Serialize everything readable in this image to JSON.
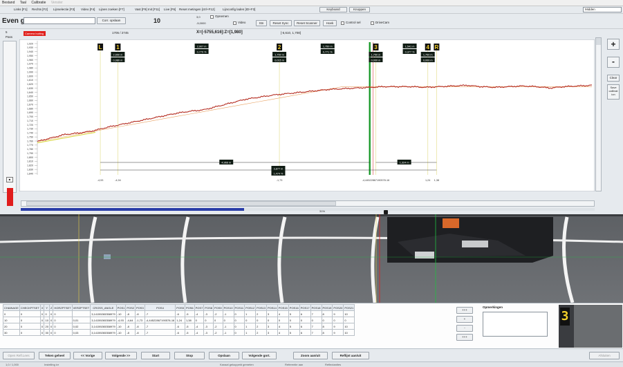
{
  "menu": [
    "Bestand",
    "Taal",
    "Calibratie",
    "Venster"
  ],
  "toolbar1": {
    "items": [
      "Links [F1]",
      "Rechts [F2]",
      "Lijnselectie [F3]",
      "Video [F4]",
      "Lijnen zoeken [F7]",
      "Vast [F9]",
      "Init [F11]",
      "Live [F6]",
      "Reset metingen [ctrl+F12]",
      "Lijnconfig laden [ID+F3]"
    ],
    "keyboard": "Keyboard",
    "knoppen": "Knoppen",
    "right_field": "Midden"
  },
  "toolbar2": {
    "title": "Even gi",
    "corr_button": "Corr. opslaan",
    "number": "10",
    "val1": "3,0",
    "val2": "-5,0000",
    "opnemen": "Opnemen",
    "video": "Video",
    "stn": "Stn",
    "reset_sync": "Reset Sync",
    "reset_scanner": "Reset Scanner",
    "hoek": "Hoek",
    "control_cb": "Control sel",
    "drivecam_cb": "DriveCam"
  },
  "chart_header": {
    "red_badge": "Camera buiting",
    "range": "1705 / 2745",
    "coords": "X=[-5755,616]:Z=[1,980]",
    "coords2": "[-5,610, 1,708]",
    "left_label": "5",
    "left_sub": "Pass"
  },
  "chart_data": {
    "type": "line",
    "yticks": [
      "1,920",
      "1,930",
      "1,940",
      "1,950",
      "1,960",
      "1,970",
      "1,980",
      "1,990",
      "1,600",
      "1,610",
      "1,620",
      "1,630",
      "1,640",
      "1,650",
      "1,660",
      "1,670",
      "1,680",
      "1,690",
      "1,700",
      "1,710",
      "1,720",
      "1,730",
      "1,740",
      "1,750",
      "1,760",
      "1,770",
      "1,780",
      "1,790",
      "1,800",
      "1,810",
      "1,820",
      "1,830",
      "1,840"
    ],
    "xticks": [
      "-4,93",
      "-4,94",
      "-1,73",
      "-4,44522867190578-16",
      "1,24",
      "1,38"
    ],
    "markers": [
      "L",
      "1",
      "2",
      "3",
      "4",
      "R"
    ],
    "marker_values": [
      [
        "2,650 m",
        "0,080 m"
      ],
      [
        "1,750 m",
        "0,015 m"
      ],
      [
        "1,750 m",
        "0,000 m"
      ],
      [
        "1,750 m",
        "0,000 m"
      ]
    ],
    "top_labels": [
      "2,907 m",
      "0,779 %",
      "1,750 m",
      "0,771 %",
      "1,541 m",
      "0,377 %"
    ],
    "bottom_labels": [
      "4,966 m",
      "3,877 m",
      "1,474 %",
      "1,324 m"
    ],
    "series": [
      {
        "values": [
          1.82,
          1.815,
          1.81,
          1.808,
          1.805,
          1.8,
          1.796,
          1.792,
          1.788,
          1.784,
          1.78,
          1.777,
          1.775,
          1.77,
          1.765,
          1.76,
          1.757,
          1.754,
          1.752,
          1.75,
          1.748,
          1.746,
          1.745,
          1.744,
          1.743,
          1.742,
          1.742,
          1.742,
          1.743,
          1.742,
          1.741,
          1.74,
          1.742,
          1.743,
          1.742,
          1.741,
          1.742,
          1.744,
          1.742,
          1.741,
          1.74
        ]
      }
    ]
  },
  "scroll": {
    "percent": "31%"
  },
  "table": {
    "headers": [
      "CHAINAGE",
      "CHECKPTSET",
      "X",
      "Y",
      "Z",
      "HORZPTSET",
      "VERZPTSET",
      "CROSS_ANGLE",
      "POS1",
      "POS2",
      "POS3",
      "POS4",
      "POS5",
      "POS6",
      "POS7",
      "POS8",
      "POS9",
      "POS10",
      "POS11",
      "POS12",
      "POS13",
      "POS14",
      "POS15",
      "POS16",
      "POS17",
      "POS18",
      "POS19",
      "POS20",
      "POS21"
    ],
    "rows": [
      [
        "0",
        "0",
        "0",
        "0",
        "0",
        "0",
        "",
        "3,14159265358979",
        "-10",
        "-8",
        "-8",
        "-7",
        "-6",
        "-5",
        "-4",
        "-3",
        "-2",
        "-1",
        "0",
        "1",
        "2",
        "3",
        "4",
        "5",
        "6",
        "7",
        "8",
        "9",
        "10"
      ],
      [
        "10",
        "0",
        "0",
        "10",
        "0",
        "0",
        "0,01",
        "3,14159265358979",
        "-4,93",
        "-4,64",
        "-1,73",
        "-4,44522867190578-16",
        "1,24",
        "1,38",
        "0",
        "0",
        "0",
        "0",
        "0",
        "0",
        "0",
        "0",
        "0",
        "0",
        "0",
        "0",
        "0",
        "0",
        "0"
      ],
      [
        "20",
        "0",
        "0",
        "20",
        "0",
        "0",
        "0,02",
        "3,14159265358979",
        "-10",
        "-8",
        "-8",
        "-7",
        "-6",
        "-5",
        "-4",
        "-3",
        "-2",
        "-1",
        "0",
        "1",
        "2",
        "3",
        "4",
        "5",
        "6",
        "7",
        "8",
        "9",
        "10"
      ],
      [
        "30",
        "0",
        "0",
        "30",
        "0",
        "0",
        "0,03",
        "3,14159265358979",
        "-10",
        "-8",
        "-8",
        "-7",
        "-6",
        "-5",
        "-4",
        "-3",
        "-2",
        "-1",
        "0",
        "1",
        "2",
        "3",
        "4",
        "5",
        "6",
        "7",
        "8",
        "9",
        "10"
      ]
    ],
    "nav_buttons": [
      "+++",
      "+",
      "-",
      "+++"
    ],
    "opmerkingen": "Opmerkingen",
    "preview_digit": "3"
  },
  "bottom_buttons": [
    "Open Refl.Lees",
    "Teken geheel",
    "<< Vorige",
    "Volgende >>",
    "Start",
    "Stop",
    "Opslaan",
    "Volgende gort.",
    "Zoom aan/uit",
    "Reflijst aan/uit",
    "Afsluiten"
  ],
  "side_buttons": {
    "plus": "+",
    "minus": "-",
    "clear": "Clear",
    "save": "Save calibrat ion"
  },
  "status": [
    "1,0 / 1,000",
    "Instelling ivr",
    "Kanaal gekoppeld gemeten",
    "Referentie aan",
    "Reflectanties"
  ],
  "colors": {
    "measured": "#b42a1e",
    "fit": "#e8a060",
    "green_line": "#1a9a2a",
    "marker_line": "#e8e4a0",
    "badge": "#e0201c"
  }
}
